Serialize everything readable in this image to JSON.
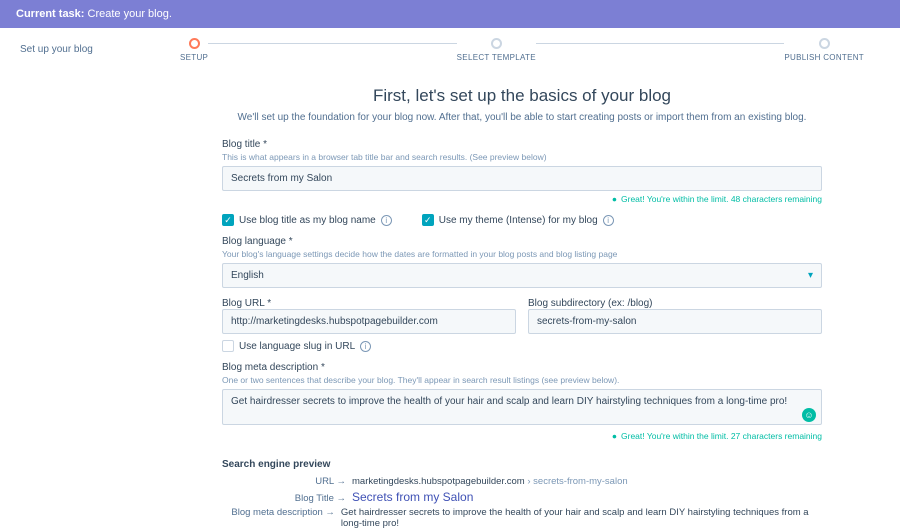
{
  "topbar": {
    "label": "Current task:",
    "task": "Create your blog."
  },
  "side": {
    "title": "Set up your blog"
  },
  "stepper": {
    "s1": "SETUP",
    "s2": "SELECT TEMPLATE",
    "s3": "PUBLISH CONTENT"
  },
  "heading": "First, let's set up the basics of your blog",
  "subheading": "We'll set up the foundation for your blog now. After that, you'll be able to start creating posts or import them from an existing blog.",
  "title_field": {
    "label": "Blog title *",
    "hint": "This is what appears in a browser tab title bar and search results. (See preview below)",
    "value": "Secrets from my Salon",
    "status": "Great! You're within the limit. 48 characters remaining"
  },
  "chk1": "Use blog title as my blog name",
  "chk2": "Use my theme (Intense) for my blog",
  "lang": {
    "label": "Blog language *",
    "hint": "Your blog's language settings decide how the dates are formatted in your blog posts and blog listing page",
    "value": "English"
  },
  "url": {
    "label": "Blog URL *",
    "value": "http://marketingdesks.hubspotpagebuilder.com"
  },
  "subdir": {
    "label": "Blog subdirectory (ex: /blog)",
    "value": "secrets-from-my-salon"
  },
  "slug": "Use language slug in URL",
  "meta": {
    "label": "Blog meta description *",
    "hint": "One or two sentences that describe your blog. They'll appear in search result listings (see preview below).",
    "value": "Get hairdresser secrets to improve the health of your hair and scalp and learn DIY hairstyling techniques from a long-time pro!",
    "status": "Great! You're within the limit. 27 characters remaining"
  },
  "preview": {
    "heading": "Search engine preview",
    "url_label": "URL",
    "url_domain": "marketingdesks.hubspotpagebuilder.com",
    "url_sep": " › ",
    "url_path": "secrets-from-my-salon",
    "title_label": "Blog Title",
    "title_value": "Secrets from my Salon",
    "meta_label": "Blog meta description",
    "meta_value": "Get hairdresser secrets to improve the health of your hair and scalp and learn DIY hairstyling techniques from a long-time pro!"
  }
}
